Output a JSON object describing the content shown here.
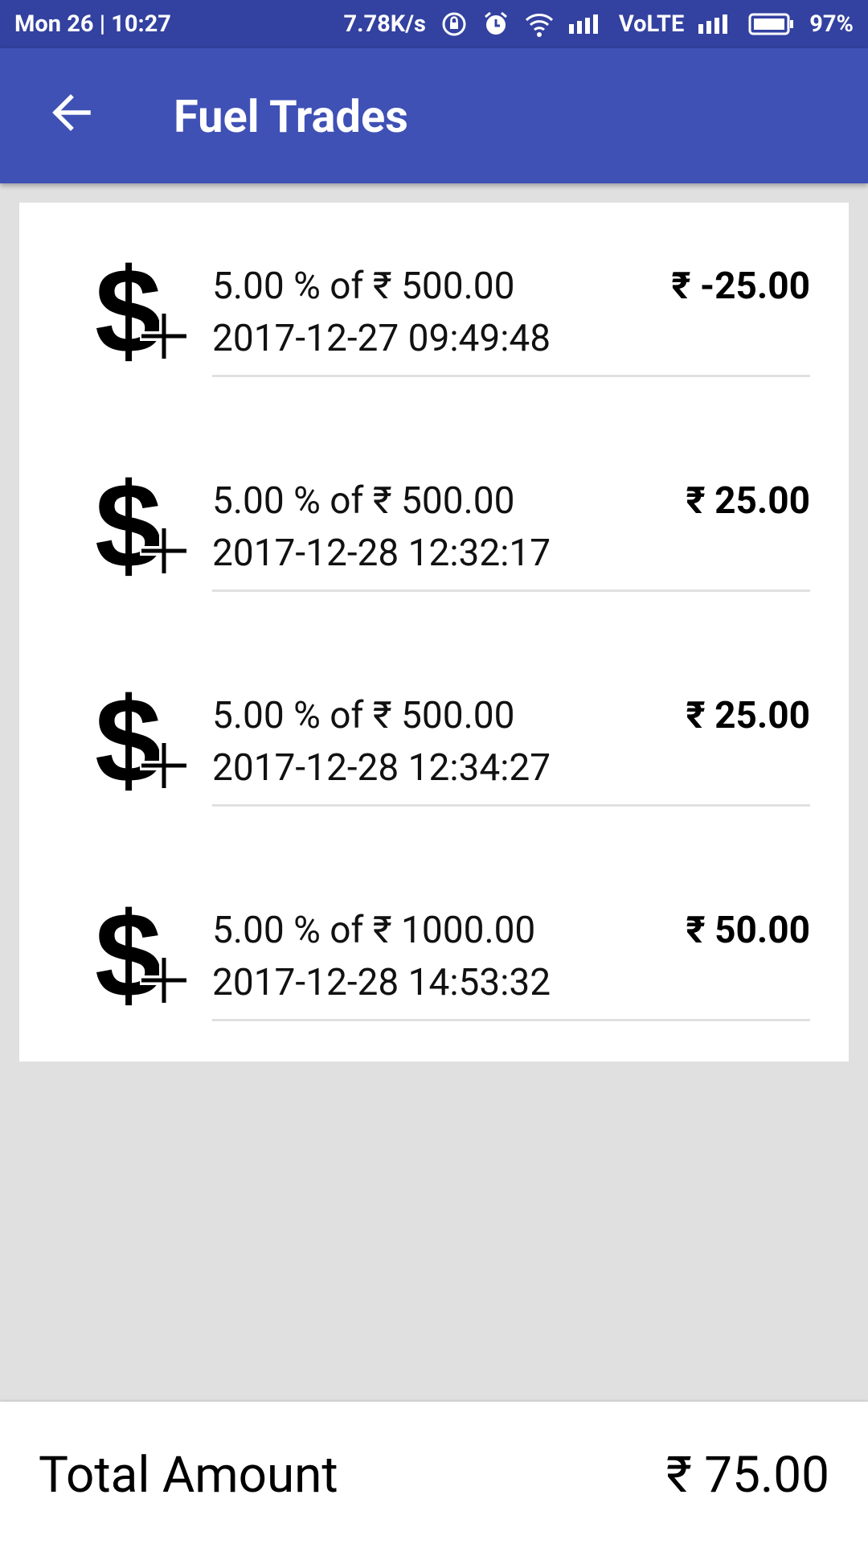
{
  "status_bar": {
    "time": "Mon 26 | 10:27",
    "speed": "7.78K/s",
    "network": "VoLTE",
    "battery": "97%"
  },
  "app_bar": {
    "title": "Fuel Trades",
    "back_icon": "arrow-left-icon"
  },
  "trades": [
    {
      "description": "5.00 % of ₹ 500.00",
      "datetime": "2017-12-27 09:49:48",
      "amount": "₹ -25.00",
      "icon": "dollar-plus-icon"
    },
    {
      "description": "5.00 % of ₹ 500.00",
      "datetime": "2017-12-28 12:32:17",
      "amount": "₹ 25.00",
      "icon": "dollar-plus-icon"
    },
    {
      "description": "5.00 % of ₹ 500.00",
      "datetime": "2017-12-28 12:34:27",
      "amount": "₹ 25.00",
      "icon": "dollar-plus-icon"
    },
    {
      "description": "5.00 % of ₹ 1000.00",
      "datetime": "2017-12-28 14:53:32",
      "amount": "₹ 50.00",
      "icon": "dollar-plus-icon"
    }
  ],
  "total": {
    "label": "Total Amount",
    "value": "₹ 75.00"
  },
  "colors": {
    "status_bar": "#3341a0",
    "app_bar": "#3f51b5",
    "background": "#e0e0e0"
  }
}
